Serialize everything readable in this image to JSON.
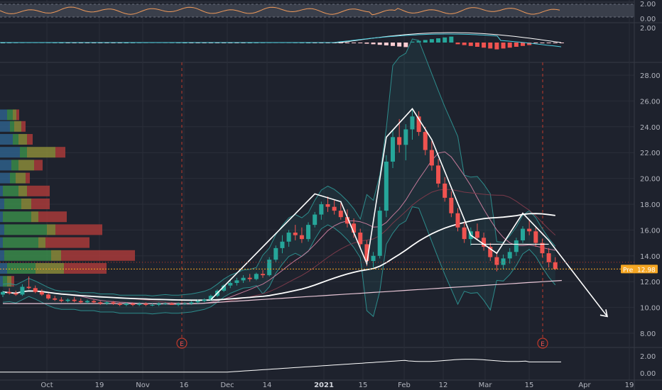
{
  "chart_data": {
    "type": "candlestick",
    "x_ticks": [
      "Oct",
      "19",
      "Nov",
      "16",
      "Dec",
      "14",
      "2021",
      "15",
      "Feb",
      "12",
      "Mar",
      "15",
      "Apr",
      "19"
    ],
    "x_ticks_bold": [
      "2021"
    ],
    "price_axis": {
      "ticks": [
        "28.00",
        "26.00",
        "24.00",
        "22.00",
        "20.00",
        "18.00",
        "16.00",
        "14.00",
        "12.00",
        "10.00",
        "8.00"
      ],
      "ylim": [
        7,
        29.5
      ]
    },
    "rsi_axis": {
      "ticks": [
        "0.00"
      ],
      "top_tick": "2.00"
    },
    "macd_axis": {
      "ticks": [
        "2.00"
      ]
    },
    "volume_axis": {
      "ticks": [
        "2.00",
        "0.00"
      ]
    },
    "price_tag": {
      "label": "Pre",
      "value": "12.98",
      "price": 12.98,
      "color": "#f5a623"
    },
    "earnings_markers": [
      {
        "label": "E",
        "date": "Nov 16"
      },
      {
        "label": "E",
        "date": "Mar 18"
      }
    ],
    "colors": {
      "up": "#26a69a",
      "down": "#ef5350",
      "pattern": "#ffffff",
      "sma_pink": "#c47a9a",
      "bb": "#2d8c8c"
    },
    "candles": [
      [
        0,
        11.0,
        11.3,
        10.8,
        11.2
      ],
      [
        1,
        11.2,
        11.5,
        11.0,
        11.1
      ],
      [
        2,
        11.1,
        11.3,
        10.9,
        11.0
      ],
      [
        3,
        11.0,
        11.8,
        10.9,
        11.6
      ],
      [
        4,
        11.6,
        12.4,
        11.4,
        11.5
      ],
      [
        5,
        11.5,
        11.7,
        11.1,
        11.2
      ],
      [
        6,
        11.2,
        11.4,
        10.9,
        11.0
      ],
      [
        7,
        11.0,
        11.1,
        10.6,
        10.7
      ],
      [
        8,
        10.7,
        10.9,
        10.5,
        10.6
      ],
      [
        9,
        10.6,
        10.8,
        10.4,
        10.5
      ],
      [
        10,
        10.5,
        10.7,
        10.4,
        10.6
      ],
      [
        11,
        10.6,
        10.8,
        10.4,
        10.5
      ],
      [
        12,
        10.5,
        10.7,
        10.3,
        10.4
      ],
      [
        13,
        10.4,
        10.6,
        10.3,
        10.5
      ],
      [
        14,
        10.5,
        10.6,
        10.3,
        10.4
      ],
      [
        15,
        10.4,
        10.5,
        10.2,
        10.3
      ],
      [
        16,
        10.3,
        10.5,
        10.2,
        10.4
      ],
      [
        17,
        10.4,
        10.5,
        10.2,
        10.3
      ],
      [
        18,
        10.3,
        10.4,
        10.1,
        10.2
      ],
      [
        19,
        10.2,
        10.4,
        10.1,
        10.3
      ],
      [
        20,
        10.3,
        10.4,
        10.1,
        10.2
      ],
      [
        21,
        10.2,
        10.4,
        10.1,
        10.3
      ],
      [
        22,
        10.3,
        10.4,
        10.1,
        10.2
      ],
      [
        23,
        10.2,
        10.3,
        10.1,
        10.2
      ],
      [
        24,
        10.2,
        10.4,
        10.1,
        10.3
      ],
      [
        25,
        10.3,
        10.4,
        10.2,
        10.3
      ],
      [
        26,
        10.3,
        10.4,
        10.2,
        10.2
      ],
      [
        27,
        10.2,
        10.4,
        10.1,
        10.3
      ],
      [
        28,
        10.3,
        10.4,
        10.2,
        10.3
      ],
      [
        29,
        10.3,
        10.5,
        10.2,
        10.4
      ],
      [
        30,
        10.4,
        10.6,
        10.3,
        10.5
      ],
      [
        31,
        10.5,
        10.7,
        10.4,
        10.6
      ],
      [
        32,
        10.6,
        11.0,
        10.5,
        10.9
      ],
      [
        33,
        10.9,
        11.4,
        10.8,
        11.3
      ],
      [
        34,
        11.3,
        11.8,
        11.2,
        11.7
      ],
      [
        35,
        11.7,
        12.1,
        11.5,
        11.9
      ],
      [
        36,
        11.9,
        12.3,
        11.7,
        12.1
      ],
      [
        37,
        12.1,
        12.5,
        11.9,
        12.3
      ],
      [
        38,
        12.3,
        12.6,
        12.0,
        12.2
      ],
      [
        39,
        12.2,
        12.7,
        12.1,
        12.6
      ],
      [
        40,
        12.6,
        12.9,
        12.3,
        12.5
      ],
      [
        41,
        12.5,
        13.9,
        12.4,
        13.7
      ],
      [
        42,
        13.7,
        14.8,
        13.5,
        14.6
      ],
      [
        43,
        14.6,
        15.6,
        14.2,
        15.1
      ],
      [
        44,
        15.1,
        16.0,
        14.7,
        15.8
      ],
      [
        45,
        15.8,
        16.4,
        15.2,
        15.6
      ],
      [
        46,
        15.6,
        16.2,
        15.0,
        15.3
      ],
      [
        47,
        15.3,
        16.6,
        15.1,
        16.4
      ],
      [
        48,
        16.4,
        17.4,
        16.2,
        17.2
      ],
      [
        49,
        17.2,
        18.2,
        16.8,
        18.0
      ],
      [
        50,
        18.0,
        18.6,
        17.4,
        17.8
      ],
      [
        51,
        17.8,
        18.3,
        17.2,
        17.5
      ],
      [
        52,
        17.5,
        18.1,
        16.8,
        17.0
      ],
      [
        53,
        17.0,
        17.6,
        16.2,
        16.5
      ],
      [
        54,
        16.5,
        16.9,
        15.4,
        15.8
      ],
      [
        55,
        15.8,
        16.1,
        14.6,
        14.9
      ],
      [
        56,
        14.9,
        15.2,
        13.2,
        13.6
      ],
      [
        57,
        13.6,
        14.3,
        13.1,
        14.0
      ],
      [
        58,
        14.0,
        17.8,
        13.8,
        17.5
      ],
      [
        59,
        17.5,
        21.8,
        17.0,
        21.3
      ],
      [
        60,
        21.3,
        23.8,
        20.8,
        23.2
      ],
      [
        61,
        23.2,
        24.6,
        22.0,
        22.6
      ],
      [
        62,
        22.6,
        24.2,
        21.4,
        23.8
      ],
      [
        63,
        23.8,
        25.3,
        23.0,
        24.8
      ],
      [
        64,
        24.8,
        25.2,
        23.3,
        23.6
      ],
      [
        65,
        23.6,
        24.0,
        21.8,
        22.2
      ],
      [
        66,
        22.2,
        22.9,
        20.6,
        21.0
      ],
      [
        67,
        21.0,
        21.5,
        19.3,
        19.6
      ],
      [
        68,
        19.6,
        20.1,
        18.2,
        18.5
      ],
      [
        69,
        18.5,
        19.0,
        17.0,
        17.3
      ],
      [
        70,
        17.3,
        17.7,
        15.9,
        16.2
      ],
      [
        71,
        16.2,
        16.6,
        15.0,
        15.3
      ],
      [
        72,
        15.3,
        16.2,
        14.8,
        15.9
      ],
      [
        73,
        15.9,
        16.5,
        15.2,
        15.4
      ],
      [
        74,
        15.4,
        15.8,
        14.4,
        14.7
      ],
      [
        75,
        14.7,
        15.0,
        13.6,
        13.9
      ],
      [
        76,
        13.9,
        14.3,
        12.8,
        13.3
      ],
      [
        77,
        13.3,
        14.1,
        13.0,
        13.8
      ],
      [
        78,
        13.8,
        14.6,
        13.4,
        14.3
      ],
      [
        79,
        14.3,
        15.4,
        14.0,
        15.2
      ],
      [
        80,
        15.2,
        16.3,
        15.0,
        16.1
      ],
      [
        81,
        16.1,
        16.8,
        15.6,
        15.9
      ],
      [
        82,
        15.9,
        16.2,
        14.7,
        15.0
      ],
      [
        83,
        15.0,
        15.3,
        13.9,
        14.2
      ],
      [
        84,
        14.2,
        14.6,
        13.1,
        13.5
      ],
      [
        85,
        13.5,
        13.9,
        12.9,
        12.98
      ]
    ],
    "pattern_lines": [
      [
        [
          32,
          10.6
        ],
        [
          48,
          18.8
        ],
        [
          52,
          18.2
        ],
        [
          56,
          13.4
        ],
        [
          59,
          23.2
        ],
        [
          63,
          25.4
        ],
        [
          66,
          23.0
        ],
        [
          72,
          15.6
        ],
        [
          76,
          14.2
        ],
        [
          80,
          17.3
        ],
        [
          84,
          15.2
        ],
        [
          93,
          9.3
        ]
      ]
    ],
    "profile_bars": [
      {
        "price": 24.9,
        "green": 8,
        "red": 4,
        "yellow": 5,
        "blue": 10
      },
      {
        "price": 24.0,
        "green": 6,
        "red": 6,
        "yellow": 10,
        "blue": 14
      },
      {
        "price": 23.0,
        "green": 8,
        "red": 8,
        "yellow": 12,
        "blue": 18
      },
      {
        "price": 22.0,
        "green": 10,
        "red": 14,
        "yellow": 40,
        "blue": 28
      },
      {
        "price": 21.0,
        "green": 10,
        "red": 12,
        "yellow": 22,
        "blue": 16
      },
      {
        "price": 20.0,
        "green": 8,
        "red": 6,
        "yellow": 14,
        "blue": 14
      },
      {
        "price": 19.0,
        "green": 22,
        "red": 32,
        "yellow": 12,
        "blue": 4
      },
      {
        "price": 18.0,
        "green": 24,
        "red": 26,
        "yellow": 14,
        "blue": 6
      },
      {
        "price": 17.0,
        "green": 40,
        "red": 40,
        "yellow": 10,
        "blue": 4
      },
      {
        "price": 16.0,
        "green": 60,
        "red": 66,
        "yellow": 12,
        "blue": 6
      },
      {
        "price": 15.0,
        "green": 50,
        "red": 62,
        "yellow": 10,
        "blue": 4
      },
      {
        "price": 14.0,
        "green": 66,
        "red": 104,
        "yellow": 14,
        "blue": 6
      },
      {
        "price": 13.0,
        "green": 40,
        "red": 60,
        "yellow": 40,
        "blue": 10
      },
      {
        "price": 12.0,
        "green": 6,
        "red": 4,
        "yellow": 6,
        "blue": 4
      }
    ]
  }
}
